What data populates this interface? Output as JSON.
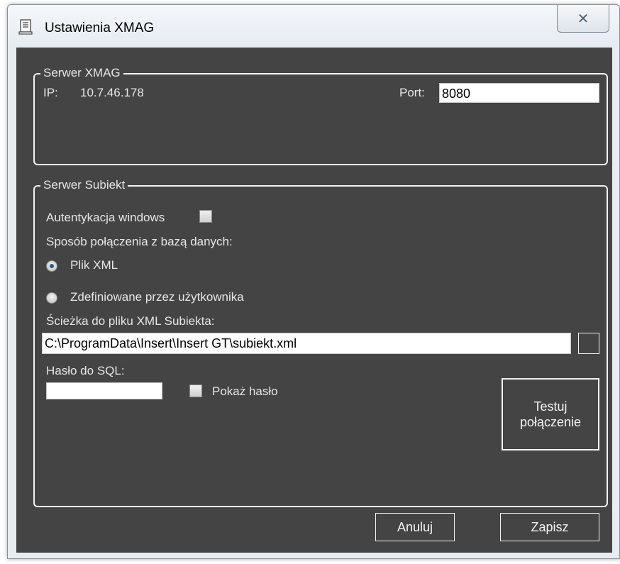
{
  "window": {
    "title": "Ustawienia XMAG",
    "icon": "app-icon",
    "close_glyph": "✕"
  },
  "xmag_group": {
    "legend": "Serwer XMAG",
    "ip_label": "IP:",
    "ip_value": "10.7.46.178",
    "port_label": "Port:",
    "port_value": "8080"
  },
  "subiekt_group": {
    "legend": "Serwer Subiekt",
    "windows_auth_label": "Autentykacja windows",
    "windows_auth_checked": false,
    "connection_method_label": "Sposób połączenia z bazą danych:",
    "radio_xml_label": "Plik XML",
    "radio_xml_checked": true,
    "radio_user_label": "Zdefiniowane przez użytkownika",
    "radio_user_checked": false,
    "xml_path_label": "Ścieżka do pliku XML Subiekta:",
    "xml_path_value": "C:\\ProgramData\\Insert\\Insert GT\\subiekt.xml",
    "sql_password_label": "Hasło do SQL:",
    "sql_password_value": "",
    "show_password_label": "Pokaż hasło",
    "show_password_checked": false,
    "test_button_line1": "Testuj",
    "test_button_line2": "połączenie"
  },
  "footer": {
    "cancel_label": "Anuluj",
    "save_label": "Zapisz"
  },
  "colors": {
    "panel_bg": "#444444",
    "text": "#e6e6e6",
    "radio_dot": "#2b5a94"
  }
}
